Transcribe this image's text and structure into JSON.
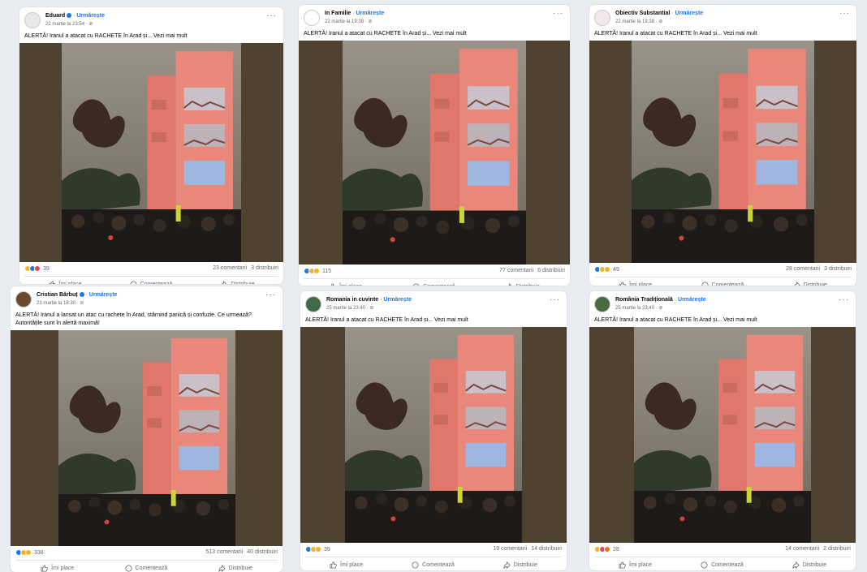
{
  "follow_label": "Urmărește",
  "more_label": "···",
  "actions": {
    "like": "Îmi place",
    "comment": "Comentează",
    "share": "Distribuie"
  },
  "posts": [
    {
      "author": "Eduard",
      "verified": true,
      "date": "22 martie la 23:54",
      "text": "ALERTĂ! Iranul a atacat cu RACHETE în Arad și... Vezi mai mult",
      "reactions_total": "39",
      "reaction_icons": [
        "haha-icon",
        "like-icon",
        "love-icon"
      ],
      "comments": "23 comentarii",
      "shares": "3 distribuiri",
      "avatar_color": "#e8e8e8"
    },
    {
      "author": "In Familie",
      "verified": false,
      "date": "22 martie la 19:38",
      "text": "ALERTĂ! Iranul a atacat cu RACHETE în Arad și... Vezi mai mult",
      "reactions_total": "115",
      "reaction_icons": [
        "like-icon",
        "haha-icon",
        "sad-icon"
      ],
      "comments": "77 comentarii",
      "shares": "6 distribuiri",
      "avatar_color": "#ffffff"
    },
    {
      "author": "Obiectiv Substantial",
      "verified": false,
      "date": "22 martie la 19:38",
      "text": "ALERTĂ! Iranul a atacat cu RACHETE în Arad și... Vezi mai mult",
      "reactions_total": "49",
      "reaction_icons": [
        "like-icon",
        "haha-icon",
        "wow-icon"
      ],
      "comments": "28 comentarii",
      "shares": "3 distribuiri",
      "avatar_color": "#f4e6ea"
    },
    {
      "author": "Cristian Bărbuț",
      "verified": true,
      "date": "23 martie la 18:30",
      "text": "ALERTĂ! Iranul a lansat un atac cu rachete în Arad, stârnind panică și confuzie. Ce urmează? Autoritățile sunt în alertă maximă!",
      "reactions_total": "338",
      "reaction_icons": [
        "like-icon",
        "haha-icon",
        "sad-icon"
      ],
      "comments": "513 comentarii",
      "shares": "40 distribuiri",
      "avatar_color": "#6b4a2f"
    },
    {
      "author": "Romania in cuvinte",
      "verified": false,
      "date": "25 martie la 23:40",
      "text": "ALERTĂ! Iranul a atacat cu RACHETE în Arad și... Vezi mai mult",
      "reactions_total": "39",
      "reaction_icons": [
        "like-icon",
        "haha-icon",
        "sad-icon"
      ],
      "comments": "19 comentarii",
      "shares": "14 distribuiri",
      "avatar_color": "#3d6b4a"
    },
    {
      "author": "România Tradițională",
      "verified": false,
      "date": "25 martie la 23:40",
      "text": "ALERTĂ! Iranul a atacat cu RACHETE în Arad și... Vezi mai mult",
      "reactions_total": "28",
      "reaction_icons": [
        "haha-icon",
        "love-icon",
        "angry-icon"
      ],
      "comments": "14 comentarii",
      "shares": "2 distribuiri",
      "avatar_color": "#4a6b3d"
    }
  ]
}
